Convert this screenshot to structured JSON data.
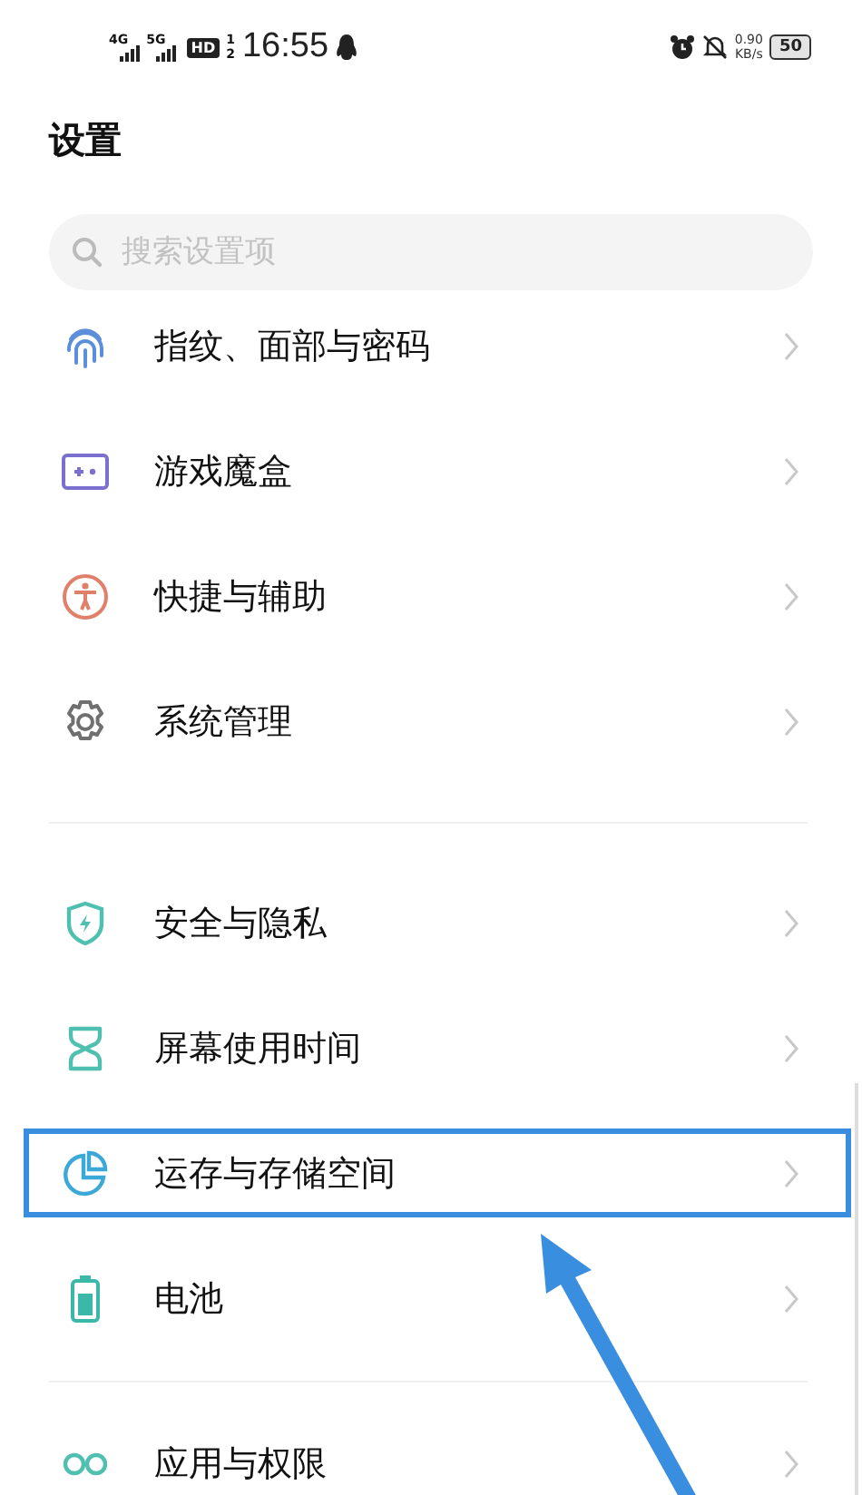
{
  "status_bar": {
    "network_1": "4G",
    "network_2": "5G",
    "hd": "HD",
    "hd_sup": "1",
    "hd_sub": "2",
    "time": "16:55",
    "speed": "0.90",
    "speed_unit": "KB/s",
    "battery": "50"
  },
  "title": "设置",
  "search": {
    "placeholder": "搜索设置项"
  },
  "groups": [
    {
      "items": [
        {
          "label": "指纹、面部与密码",
          "color": "#5b8fd9",
          "highlighted": false
        },
        {
          "label": "游戏魔盒",
          "color": "#7b6fd0",
          "highlighted": false
        },
        {
          "label": "快捷与辅助",
          "color": "#e0806a",
          "highlighted": false
        },
        {
          "label": "系统管理",
          "color": "#707070",
          "highlighted": false
        }
      ]
    },
    {
      "items": [
        {
          "label": "安全与隐私",
          "color": "#4fbfb0",
          "highlighted": false
        },
        {
          "label": "屏幕使用时间",
          "color": "#4fbfb0",
          "highlighted": false
        },
        {
          "label": "运存与存储空间",
          "color": "#3ba8d8",
          "highlighted": true
        },
        {
          "label": "电池",
          "color": "#3bb8a8",
          "highlighted": false
        }
      ]
    },
    {
      "items": [
        {
          "label": "应用与权限",
          "color": "#4fbfb0",
          "highlighted": false
        }
      ]
    }
  ]
}
